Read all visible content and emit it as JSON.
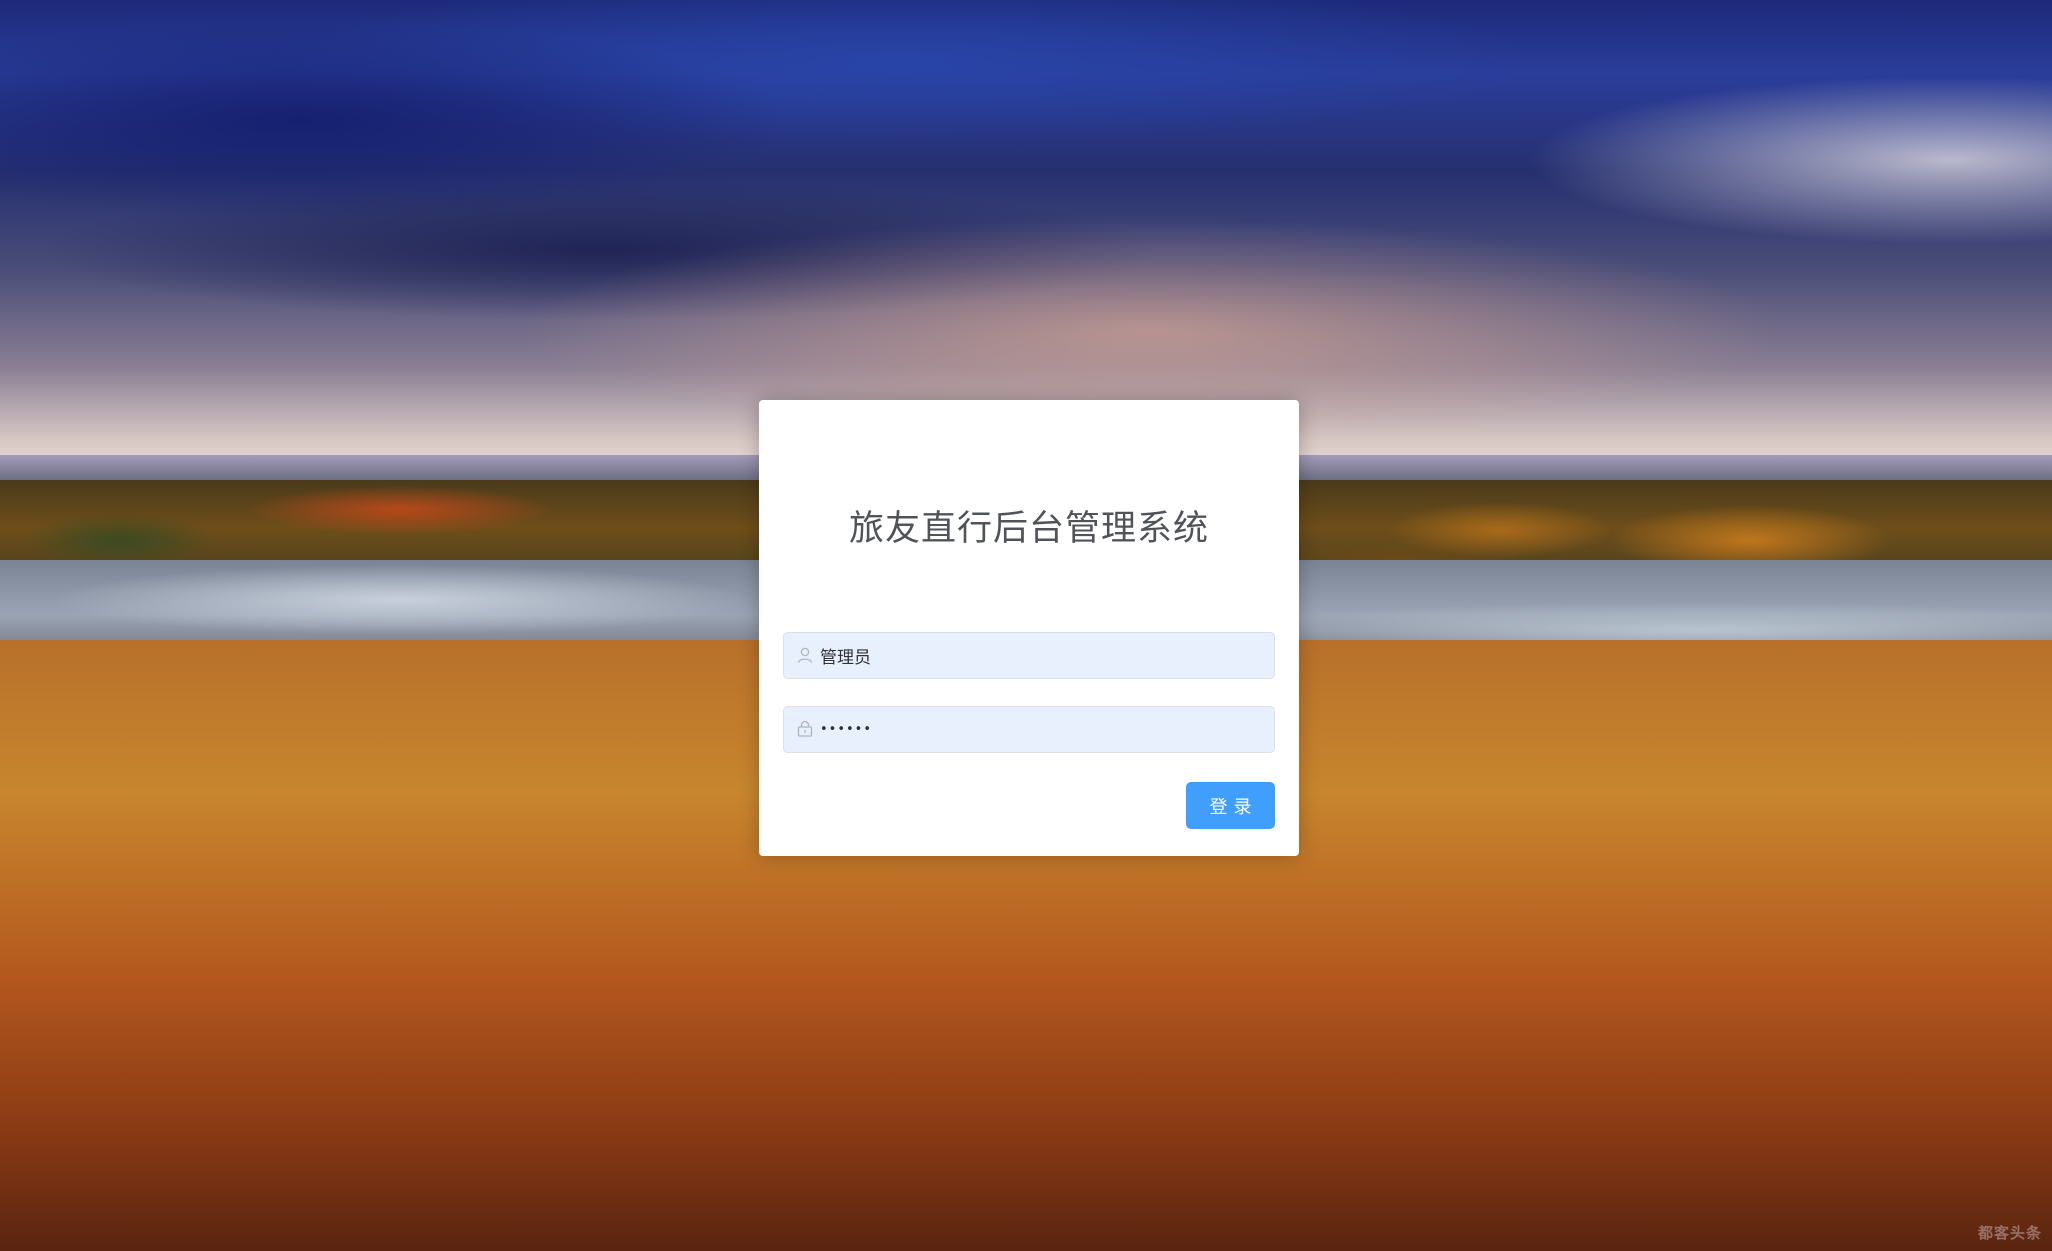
{
  "login": {
    "title": "旅友直行后台管理系统",
    "username": {
      "value": "管理员",
      "icon": "user-icon"
    },
    "password": {
      "value": "••••••",
      "icon": "lock-icon"
    },
    "submit_label": "登录"
  },
  "background": {
    "description_icon": "landscape-photo",
    "watermark": "都客头条"
  },
  "colors": {
    "primary": "#409eff",
    "input_bg": "#e8f0fe",
    "title": "#505458"
  }
}
